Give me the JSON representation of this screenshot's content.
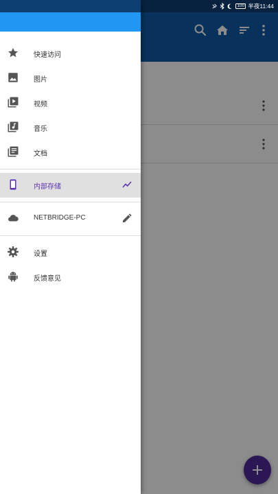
{
  "status_bar": {
    "time": "半夜11:44",
    "battery": "100"
  },
  "toolbar": {
    "icons": [
      "search-icon",
      "home-icon",
      "sort-icon",
      "more-vert-icon"
    ]
  },
  "drawer": {
    "sections": [
      {
        "items": [
          {
            "label": "快速访问",
            "icon": "star-icon"
          },
          {
            "label": "图片",
            "icon": "image-icon"
          },
          {
            "label": "视频",
            "icon": "video-icon"
          },
          {
            "label": "音乐",
            "icon": "music-icon"
          },
          {
            "label": "文档",
            "icon": "document-icon"
          }
        ]
      },
      {
        "items": [
          {
            "label": "内部存储",
            "icon": "phone-icon",
            "trailing_icon": "usage-chart-icon",
            "selected": true
          }
        ]
      },
      {
        "items": [
          {
            "label": "NETBRIDGE-PC",
            "icon": "cloud-icon",
            "trailing_icon": "edit-icon"
          }
        ]
      },
      {
        "items": [
          {
            "label": "设置",
            "icon": "settings-icon"
          },
          {
            "label": "反馈意见",
            "icon": "android-icon"
          }
        ]
      }
    ]
  },
  "fab": {
    "icon": "plus-icon"
  },
  "colors": {
    "primary": "#0f5ca8",
    "drawer_header": "#2196f3",
    "accent": "#5e35b1",
    "fab": "#4d2b98"
  }
}
